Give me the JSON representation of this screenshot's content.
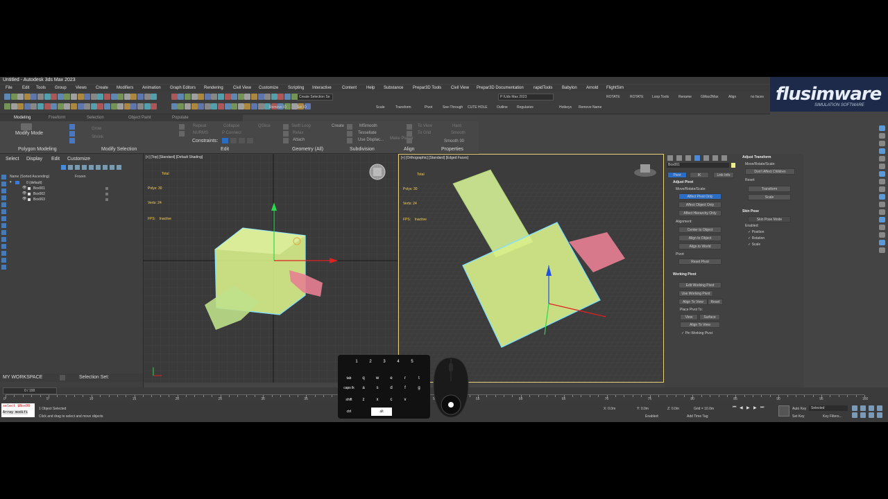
{
  "window": {
    "title": "Untitled - Autodesk 3ds Max 2023"
  },
  "menu": [
    "File",
    "Edit",
    "Tools",
    "Group",
    "Views",
    "Create",
    "Modifiers",
    "Animation",
    "Graph Editors",
    "Rendering",
    "Civil View",
    "Customize",
    "Scripting",
    "Interactive",
    "Content",
    "Help",
    "Substance",
    "Prepar3D Tools",
    "Civil View",
    "Prepar3D Documentation",
    "rapidTools",
    "Babylon",
    "Arnold",
    "FlightSim"
  ],
  "toolbar": {
    "selection_set": "Create Selection Se",
    "workspace_dropdown": "P:\\Uds Max 2023",
    "labels_row2": [
      "Remove ID",
      "Set ID",
      "Scale",
      "Transform",
      "Pivot",
      "See-Through",
      "CUTE HOLE",
      "Outline",
      "Regularize",
      "Hotkeys",
      "Remove Name"
    ],
    "labels_row1_right": [
      "ROTATE",
      "ROTATE",
      "Loop Tools",
      "Rename",
      "GMax2Max",
      "Align",
      "no faces"
    ]
  },
  "ribbon": {
    "tabs": [
      "Modeling",
      "Freeform",
      "Selection",
      "Object Paint",
      "Populate"
    ],
    "modify_mode": "Modify Mode",
    "items": [
      "Repeat",
      "Collapse",
      "QSlice",
      "Swift Loop",
      "Create",
      "MSmooth",
      "To View",
      "Hard",
      "Grow",
      "Shrink",
      "NURMS",
      "P Connect",
      "Relax",
      "Tessellate",
      "To Grid",
      "Smooth",
      "Attach",
      "Use Displac...",
      "Make Planar",
      "Smooth 30"
    ],
    "constraints": "Constraints:",
    "sections": [
      "Polygon Modeling",
      "Modify Selection",
      "Edit",
      "Geometry (All)",
      "Subdivision",
      "Align",
      "Properties"
    ]
  },
  "logo": {
    "text": "flusimware",
    "sub": "SIMULATION SOFTWARE"
  },
  "scene_explorer": {
    "tabs": [
      "Select",
      "Display",
      "Edit",
      "Customize"
    ],
    "columns": [
      "Name (Sorted Ascending)",
      "Frozen"
    ],
    "root": "0 (default)",
    "items": [
      "Box001",
      "Box002",
      "Box003"
    ]
  },
  "viewports": {
    "left_label": "[+] [Top] [Standard] [Default Shading]",
    "right_label": "[+] [Orthographic] [Standard] [Edged Faces]",
    "stats": {
      "total": "Total",
      "polys": "Polys: 30",
      "verts": "Verts: 24",
      "fps": "FPS:",
      "fps_val": "Inactive"
    }
  },
  "command_panel": {
    "object_name": "Box001",
    "tabs": [
      "Pivot",
      "IK",
      "Link Info"
    ],
    "adjust_pivot": "Adjust Pivot",
    "move_rotate_scale": "Move/Rotate/Scale:",
    "affect_buttons": [
      "Affect Pivot Only",
      "Affect Object Only",
      "Affect Hierarchy Only"
    ],
    "alignment": "Alignment:",
    "align_buttons": [
      "Center to Object",
      "Align to Object",
      "Align to World"
    ],
    "pivot": "Pivot:",
    "reset_pivot": "Reset Pivot",
    "working_pivot": "Working Pivot",
    "working_buttons": [
      "Edit Working Pivot",
      "Use Working Pivot",
      "Align To View",
      "Reset"
    ],
    "place_pivot_to": "Place Pivot To:",
    "place_buttons": [
      "View",
      "Surface"
    ],
    "pin_working_pivot": "Pin Working Pivot",
    "adjust_transform": "Adjust Transform",
    "move_rotate_scale2": "Move/Rotate/Scale:",
    "dont_affect_children": "Don't Affect Children",
    "reset": "Reset:",
    "transform_btn": "Transform",
    "scale_btn": "Scale",
    "skin_pose": "Skin Pose",
    "skin_pose_mode": "Skin Pose Mode",
    "enabled": "Enabled:",
    "checks": [
      "Position",
      "Rotation",
      "Scale"
    ]
  },
  "workspace": {
    "label": "MY WORKSPACE",
    "selection_set": "Selection Set:"
  },
  "timeline": {
    "frame": "0 / 100",
    "ticks": [
      "0",
      "5",
      "10",
      "15",
      "20",
      "25",
      "30",
      "35",
      "40",
      "45",
      "50",
      "55",
      "60",
      "65",
      "70",
      "75",
      "80",
      "85",
      "90",
      "95",
      "100"
    ]
  },
  "status": {
    "selected": "1 Object Selected",
    "hint": "Click and drag to select and move objects",
    "script_lines": [
      "select $Box00",
      "Array modifi"
    ],
    "x": "X: 0.0m",
    "y": "Y: 0.0m",
    "z": "Z: 0.0m",
    "grid": "Grid = 10.0m",
    "enabled": "Enabled:",
    "add_time_tag": "Add Time Tag",
    "auto_key": "Auto Key",
    "set_key": "Set Key",
    "selected_dropdown": "Selected",
    "key_filters": "Key Filters..."
  },
  "overlay_keyboard": {
    "numbers": [
      "1",
      "2",
      "3",
      "4",
      "5"
    ],
    "row_tab": [
      "tab",
      "q",
      "w",
      "e",
      "r",
      "t"
    ],
    "row_caps": [
      "caps lk",
      "a",
      "s",
      "d",
      "f",
      "g"
    ],
    "row_shift": [
      "shift",
      "z",
      "x",
      "c",
      "v"
    ],
    "row_ctrl": [
      "ctrl",
      "alt"
    ],
    "active_key": "alt"
  },
  "colors": {
    "box_fill": "#d8ee8a",
    "box_edge": "#7fe0ff",
    "pink_box": "#e87f92",
    "selection_blue": "#2b6cc4",
    "stats_yellow": "#ffd24a"
  }
}
